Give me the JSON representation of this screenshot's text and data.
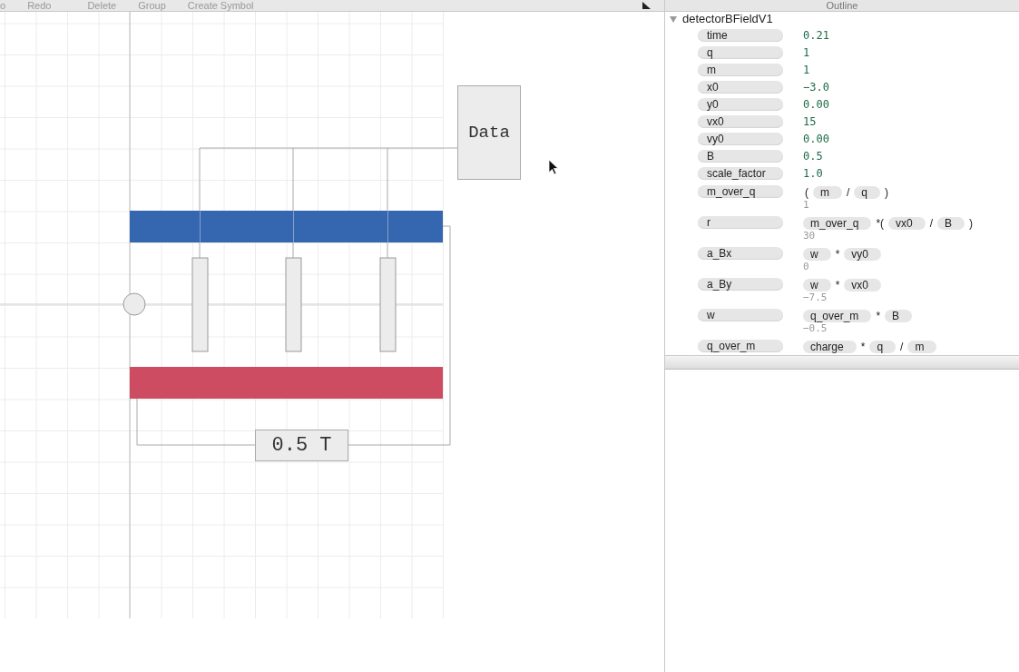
{
  "toolbar": [
    {
      "label": "o"
    },
    {
      "label": "Redo"
    },
    {
      "label": "Delete"
    },
    {
      "label": "Group"
    },
    {
      "label": "Create Symbol"
    }
  ],
  "canvas": {
    "data_box": "Data",
    "field_label": "0.5 T",
    "plates": [
      {
        "color": "#3566b0"
      },
      {
        "color": "#cd4c61"
      }
    ]
  },
  "outline": {
    "title": "Outline",
    "root": {
      "name": "detectorBFieldV1",
      "expanded": true,
      "variables": [
        {
          "name": "time",
          "kind": "value",
          "value": "0.21"
        },
        {
          "name": "q",
          "kind": "value",
          "value": "1"
        },
        {
          "name": "m",
          "kind": "value",
          "value": "1"
        },
        {
          "name": "x0",
          "kind": "value",
          "value": "−3.0"
        },
        {
          "name": "y0",
          "kind": "value",
          "value": "0.00"
        },
        {
          "name": "vx0",
          "kind": "value",
          "value": "15"
        },
        {
          "name": "vy0",
          "kind": "value",
          "value": "0.00"
        },
        {
          "name": "B",
          "kind": "value",
          "value": "0.5"
        },
        {
          "name": "scale_factor",
          "kind": "value",
          "value": "1.0"
        },
        {
          "name": "m_over_q",
          "kind": "formula",
          "tokens": [
            {
              "kind": "op",
              "text": "("
            },
            {
              "kind": "ref",
              "text": "m"
            },
            {
              "kind": "op",
              "text": "/"
            },
            {
              "kind": "ref",
              "text": "q"
            },
            {
              "kind": "op",
              "text": ")"
            }
          ],
          "result": "1"
        },
        {
          "name": "r",
          "kind": "formula",
          "tokens": [
            {
              "kind": "ref",
              "text": "m_over_q"
            },
            {
              "kind": "op",
              "text": "*("
            },
            {
              "kind": "ref",
              "text": "vx0"
            },
            {
              "kind": "op",
              "text": "/"
            },
            {
              "kind": "ref",
              "text": "B"
            },
            {
              "kind": "op",
              "text": ")"
            }
          ],
          "result": "30"
        },
        {
          "name": "a_Bx",
          "kind": "formula",
          "tokens": [
            {
              "kind": "ref",
              "text": "w"
            },
            {
              "kind": "op",
              "text": "*"
            },
            {
              "kind": "ref",
              "text": "vy0"
            }
          ],
          "result": "0"
        },
        {
          "name": "a_By",
          "kind": "formula",
          "tokens": [
            {
              "kind": "ref",
              "text": "w"
            },
            {
              "kind": "op",
              "text": "*"
            },
            {
              "kind": "ref",
              "text": "vx0"
            }
          ],
          "result": "−7.5"
        },
        {
          "name": "w",
          "kind": "formula",
          "tokens": [
            {
              "kind": "ref",
              "text": "q_over_m"
            },
            {
              "kind": "op",
              "text": "*"
            },
            {
              "kind": "ref",
              "text": "B"
            }
          ],
          "result": "−0.5"
        },
        {
          "name": "q_over_m",
          "kind": "formula",
          "tokens": [
            {
              "kind": "ref",
              "text": "charge"
            },
            {
              "kind": "op",
              "text": "*"
            },
            {
              "kind": "ref",
              "text": "q"
            },
            {
              "kind": "op",
              "text": "/"
            },
            {
              "kind": "ref",
              "text": "m"
            }
          ]
        }
      ]
    }
  }
}
